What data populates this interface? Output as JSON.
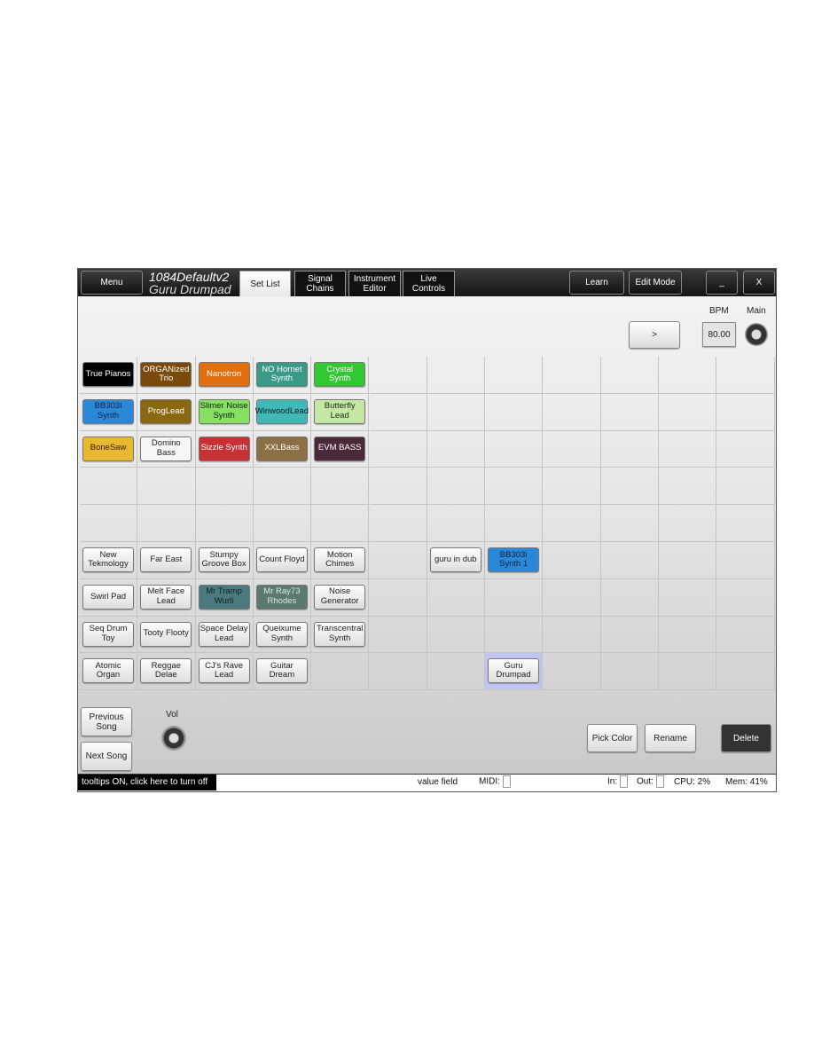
{
  "header": {
    "menu": "Menu",
    "title_line1": "1084Defaultv2",
    "title_line2": "Guru Drumpad",
    "tabs": [
      {
        "label": "Set List",
        "active": true
      },
      {
        "label": "Signal Chains"
      },
      {
        "label": "Instrument Editor"
      },
      {
        "label": "Live Controls"
      }
    ],
    "learn": "Learn",
    "edit_mode": "Edit Mode",
    "minimize": "_",
    "close": "X"
  },
  "transport": {
    "next_label": ">",
    "bpm_label": "BPM",
    "bpm_value": "80.00",
    "main_label": "Main"
  },
  "grid": {
    "rows": [
      [
        {
          "label": "True Pianos",
          "color": "#000000",
          "text": "#ffffff"
        },
        {
          "label": "ORGANized Trio",
          "color": "#7a4a0c",
          "text": "#ffffff"
        },
        {
          "label": "Nanotron",
          "color": "#e0700e",
          "text": "#ffffff"
        },
        {
          "label": "NO Hornet Synth",
          "color": "#3a9a88",
          "text": "#ffffff"
        },
        {
          "label": "Crystal Synth",
          "color": "#33c833",
          "text": "#ffffff"
        },
        null,
        null,
        null,
        null,
        null,
        null,
        null
      ],
      [
        {
          "label": "BB303i Synth",
          "color": "#2a88d8",
          "text": "#102040"
        },
        {
          "label": "ProgLead",
          "color": "#8a6812",
          "text": "#ffffff"
        },
        {
          "label": "Slimer Noise Synth",
          "color": "#88e060",
          "text": "#102010"
        },
        {
          "label": "WinwoodLead",
          "color": "#40b8b8",
          "text": "#102020"
        },
        {
          "label": "Butterfly Lead",
          "color": "#c4e8a4",
          "text": "#203010"
        },
        null,
        null,
        null,
        null,
        null,
        null,
        null
      ],
      [
        {
          "label": "BoneSaw",
          "color": "#e8b830",
          "text": "#302000"
        },
        {
          "label": "Domino Bass",
          "color": "#f6f6f6",
          "text": "#222222"
        },
        {
          "label": "Sizzle Synth",
          "color": "#c83034",
          "text": "#ffffff"
        },
        {
          "label": "XXLBass",
          "color": "#8a7044",
          "text": "#ffffff"
        },
        {
          "label": "EVM BASS",
          "color": "#4a2a3a",
          "text": "#ffffff"
        },
        null,
        null,
        null,
        null,
        null,
        null,
        null
      ],
      [
        null,
        null,
        null,
        null,
        null,
        null,
        null,
        null,
        null,
        null,
        null,
        null
      ],
      [
        null,
        null,
        null,
        null,
        null,
        null,
        null,
        null,
        null,
        null,
        null,
        null
      ],
      [
        {
          "label": "New Tekmology"
        },
        {
          "label": "Far East"
        },
        {
          "label": "Stumpy Groove Box"
        },
        {
          "label": "Count Floyd"
        },
        {
          "label": "Motion Chimes"
        },
        null,
        {
          "label": "guru in dub"
        },
        {
          "label": "BB303i Synth 1",
          "color": "#2a88d8",
          "text": "#102040"
        },
        null,
        null,
        null,
        null
      ],
      [
        {
          "label": "Swirl Pad"
        },
        {
          "label": "Melt Face Lead"
        },
        {
          "label": "Mr Tramp Wurli",
          "color": "#4a7a80",
          "text": "#102020"
        },
        {
          "label": "Mr Ray73 Rhodes",
          "color": "#5a7a70",
          "text": "#d8e8e0"
        },
        {
          "label": "Noise Generator"
        },
        null,
        null,
        null,
        null,
        null,
        null,
        null
      ],
      [
        {
          "label": "Seq Drum Toy"
        },
        {
          "label": "Tooty Flooty"
        },
        {
          "label": "Space Delay Lead"
        },
        {
          "label": "Queixume Synth"
        },
        {
          "label": "Transcentral Synth"
        },
        null,
        null,
        null,
        null,
        null,
        null,
        null
      ],
      [
        {
          "label": "Atomic Organ"
        },
        {
          "label": "Reggae Delae"
        },
        {
          "label": "CJ's Rave Lead"
        },
        {
          "label": "Guitar Dream"
        },
        null,
        null,
        null,
        {
          "label": "Guru Drumpad",
          "selected": true
        },
        null,
        null,
        null,
        null
      ]
    ]
  },
  "bottom": {
    "previous_song": "Previous Song",
    "next_song": "Next Song",
    "vol_label": "Vol",
    "pick_color": "Pick Color",
    "rename": "Rename",
    "delete": "Delete"
  },
  "status": {
    "tooltips": "tooltips ON, click here to turn off",
    "value_field": "value field",
    "midi": "MIDI:",
    "in": "In:",
    "out": "Out:",
    "cpu": "CPU: 2%",
    "mem": "Mem: 41%"
  }
}
